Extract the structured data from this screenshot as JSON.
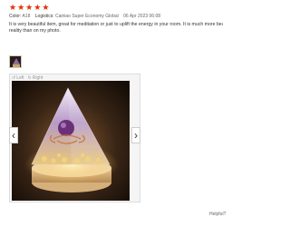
{
  "rating": {
    "stars": 5,
    "filled": 5,
    "color": "#e62e04"
  },
  "meta": {
    "color_key": "Color:",
    "color_val": "A18",
    "logistics_key": "Logistics:",
    "logistics_val": "Cainiao Super Economy Global",
    "date": "06 Apr 2023 06:08"
  },
  "review": {
    "line1": "It is very beautiful item, great for meditation or just to uplift the energy in your room. It is much more beautiful in",
    "line2": "reality than on my photo."
  },
  "viewer": {
    "rotate_left": "Left",
    "rotate_right": "Right"
  },
  "actions": {
    "helpful": "Helpful?"
  }
}
